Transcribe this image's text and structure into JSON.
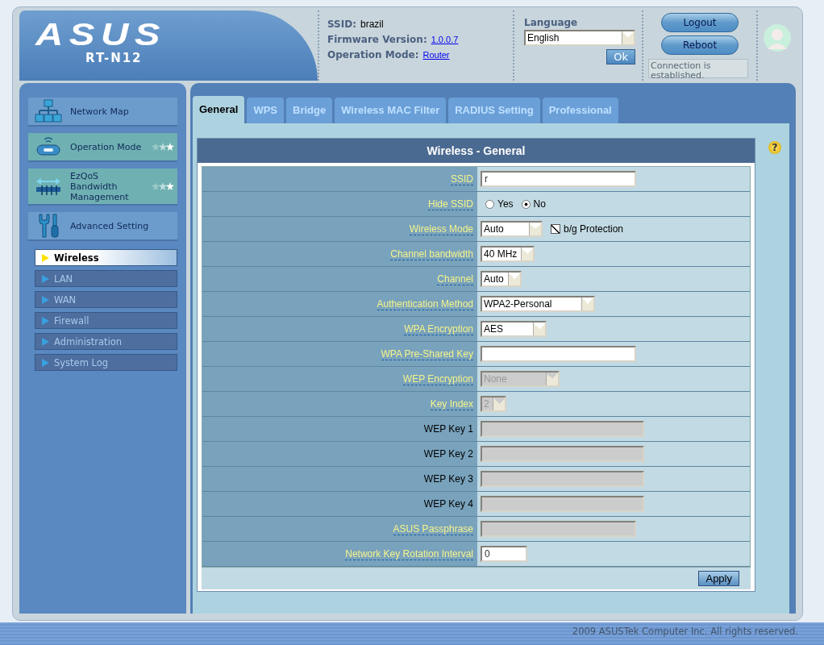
{
  "header": {
    "logo": {
      "brand": "ASUS",
      "model": "RT-N12"
    },
    "info": [
      {
        "label": "SSID:",
        "value": "brazil",
        "link": false
      },
      {
        "label": "Firmware Version:",
        "value": "1.0.0.7",
        "link": true
      },
      {
        "label": "Operation Mode:",
        "value": "Router",
        "link": true
      }
    ],
    "language": {
      "label": "Language",
      "value": "English",
      "button": "Ok"
    },
    "buttons": [
      "Logout",
      "Reboot"
    ],
    "tooltip": "Connection is established."
  },
  "sidebar": {
    "items": [
      {
        "label": "Network Map",
        "kind": "page"
      },
      {
        "label": "Operation Mode",
        "kind": "quick"
      },
      {
        "label": "EzQoS Bandwidth Management",
        "kind": "quick"
      },
      {
        "label": "Advanced Setting",
        "kind": "page"
      }
    ],
    "submenu": [
      {
        "label": "Wireless",
        "selected": true
      },
      {
        "label": "LAN",
        "selected": false
      },
      {
        "label": "WAN",
        "selected": false
      },
      {
        "label": "Firewall",
        "selected": false
      },
      {
        "label": "Administration",
        "selected": false
      },
      {
        "label": "System Log",
        "selected": false
      }
    ]
  },
  "tabs": [
    {
      "label": "General",
      "selected": true
    },
    {
      "label": "WPS",
      "selected": false
    },
    {
      "label": "Bridge",
      "selected": false
    },
    {
      "label": "Wireless MAC Filter",
      "selected": false
    },
    {
      "label": "RADIUS Setting",
      "selected": false
    },
    {
      "label": "Professional",
      "selected": false
    }
  ],
  "help_mark": "?",
  "panel": {
    "title": "Wireless - General",
    "rows": [
      {
        "label": "SSID",
        "help": true,
        "kind": "text",
        "value": "r",
        "disabled": false
      },
      {
        "label": "Hide SSID",
        "help": true,
        "kind": "radio",
        "options": [
          {
            "label": "Yes",
            "selected": false
          },
          {
            "label": "No",
            "selected": true
          }
        ]
      },
      {
        "label": "Wireless Mode",
        "help": true,
        "kind": "select",
        "value": "Auto",
        "disabled": false,
        "checkbox": {
          "label": "b/g Protection",
          "checked": true
        }
      },
      {
        "label": "Channel bandwidth",
        "help": true,
        "kind": "select",
        "value": "40 MHz",
        "disabled": false
      },
      {
        "label": "Channel",
        "help": true,
        "kind": "select",
        "value": "Auto",
        "disabled": false
      },
      {
        "label": "Authentication Method",
        "help": true,
        "kind": "select",
        "value": "WPA2-Personal",
        "disabled": false
      },
      {
        "label": "WPA Encryption",
        "help": true,
        "kind": "select",
        "value": "AES",
        "disabled": false
      },
      {
        "label": "WPA Pre-Shared Key",
        "help": true,
        "kind": "text",
        "disabled": false
      },
      {
        "label": "WEP Encryption",
        "help": true,
        "kind": "select",
        "value": "None",
        "disabled": true
      },
      {
        "label": "Key Index",
        "help": true,
        "kind": "select",
        "value": "2",
        "disabled": true
      },
      {
        "label": "WEP Key 1",
        "help": false,
        "kind": "text",
        "disabled": true
      },
      {
        "label": "WEP Key 2",
        "help": false,
        "kind": "text",
        "disabled": true
      },
      {
        "label": "WEP Key 3",
        "help": false,
        "kind": "text",
        "disabled": true
      },
      {
        "label": "WEP Key 4",
        "help": false,
        "kind": "text",
        "disabled": true
      },
      {
        "label": "ASUS Passphrase",
        "help": true,
        "kind": "text",
        "disabled": true
      },
      {
        "label": "Network Key Rotation Interval",
        "help": true,
        "kind": "text",
        "value": "0",
        "disabled": false
      }
    ],
    "button": "Apply"
  },
  "footer": "2009 ASUSTek Computer Inc. All rights reserved."
}
